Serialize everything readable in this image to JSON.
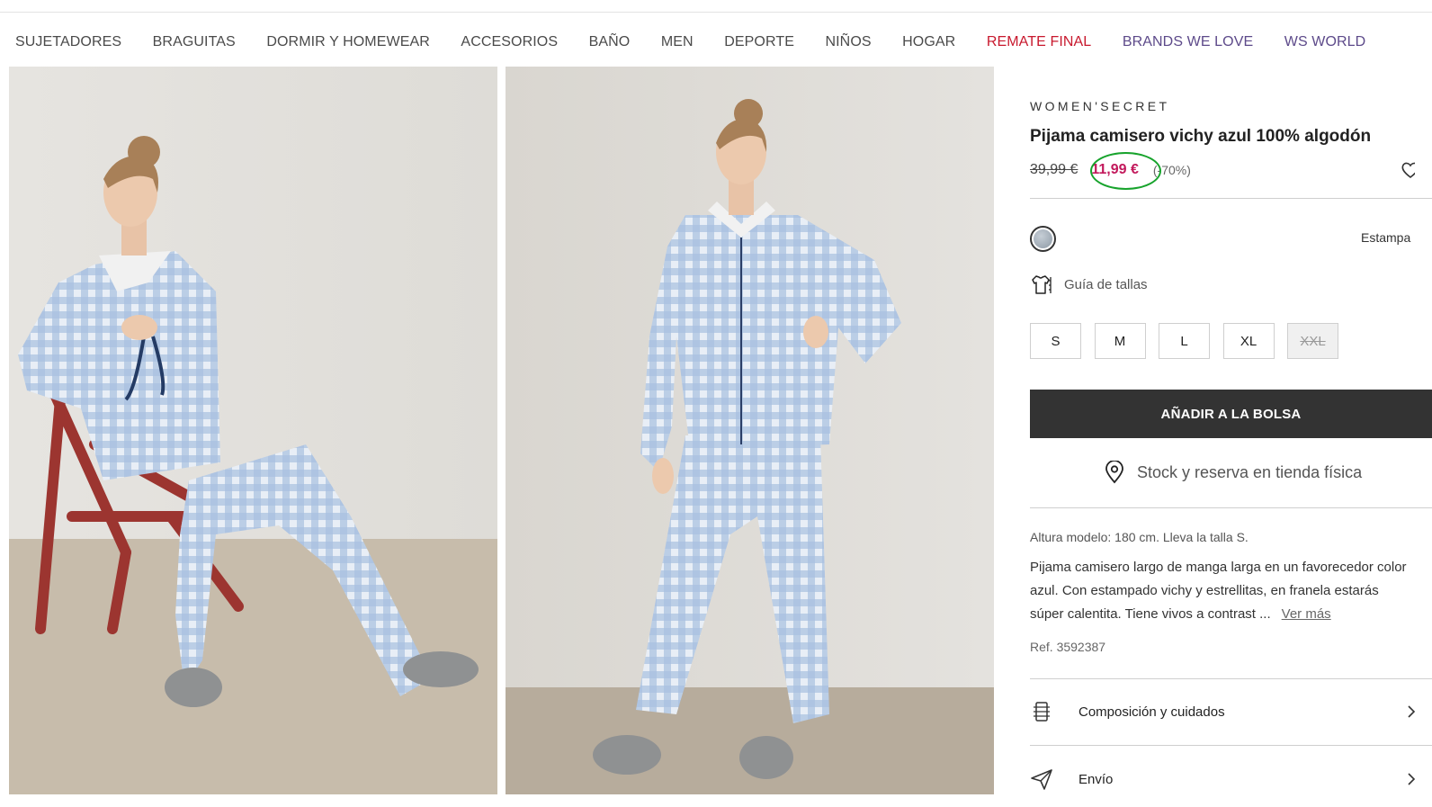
{
  "nav": {
    "items": [
      {
        "label": "SUJETADORES"
      },
      {
        "label": "BRAGUITAS"
      },
      {
        "label": "DORMIR Y HOMEWEAR"
      },
      {
        "label": "ACCESORIOS"
      },
      {
        "label": "BAÑO"
      },
      {
        "label": "MEN"
      },
      {
        "label": "DEPORTE"
      },
      {
        "label": "NIÑOS"
      },
      {
        "label": "HOGAR"
      },
      {
        "label": "REMATE FINAL"
      },
      {
        "label": "BRANDS WE LOVE"
      },
      {
        "label": "WS WORLD"
      }
    ]
  },
  "product": {
    "brand": "WOMEN'SECRET",
    "title": "Pijama camisero vichy azul 100% algodón",
    "old_price": "39,99 €",
    "new_price": "11,99 €",
    "discount": "(-70%)",
    "color_label": "Estampa",
    "size_guide_label": "Guía de tallas",
    "sizes": [
      {
        "label": "S",
        "available": true
      },
      {
        "label": "M",
        "available": true
      },
      {
        "label": "L",
        "available": true
      },
      {
        "label": "XL",
        "available": true
      },
      {
        "label": "XXL",
        "available": false
      }
    ],
    "add_to_bag_label": "AÑADIR A LA BOLSA",
    "stock_label": "Stock y reserva en tienda física",
    "model_info": "Altura modelo: 180 cm.  Lleva la talla S.",
    "description": "Pijama camisero largo de manga larga en un favorecedor color azul. Con estampado vichy y estrellitas, en franela estarás súper calentita. Tiene vivos a contrast ...",
    "more_label": "Ver más",
    "ref": "Ref. 3592387",
    "accordion": [
      {
        "label": "Composición y cuidados",
        "icon": "care-label-icon"
      },
      {
        "label": "Envío",
        "icon": "send-icon"
      }
    ]
  },
  "colors": {
    "sale": "#c8192e",
    "price_accent": "#c2185b",
    "highlight_circle": "#17a32c",
    "button_bg": "#333333"
  }
}
